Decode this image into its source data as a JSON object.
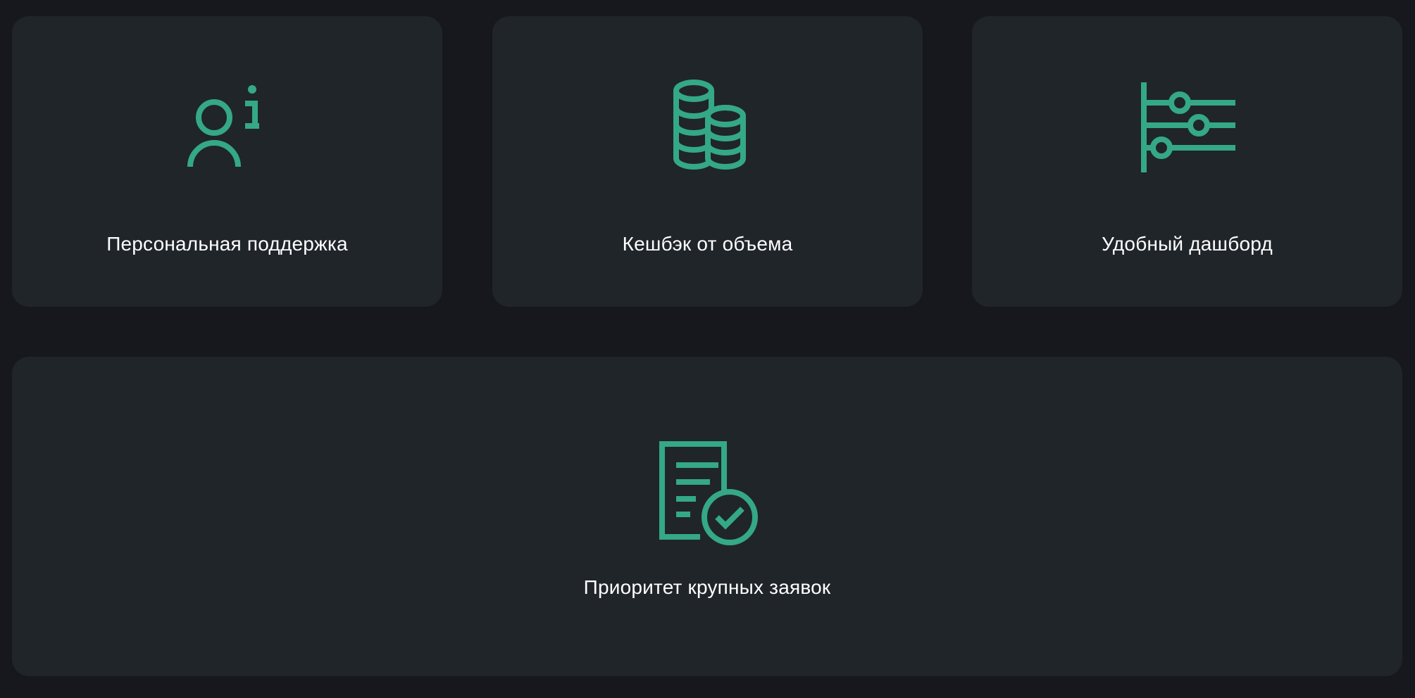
{
  "theme": {
    "background": "#16181d",
    "card": "#20252a",
    "accent": "#34a887",
    "text": "#ffffff"
  },
  "features": [
    {
      "icon": "person-info-icon",
      "label": "Персональная поддержка"
    },
    {
      "icon": "coins-stack-icon",
      "label": "Кешбэк от объема"
    },
    {
      "icon": "sliders-dashboard-icon",
      "label": "Удобный дашборд"
    },
    {
      "icon": "document-check-icon",
      "label": "Приоритет крупных заявок"
    }
  ]
}
